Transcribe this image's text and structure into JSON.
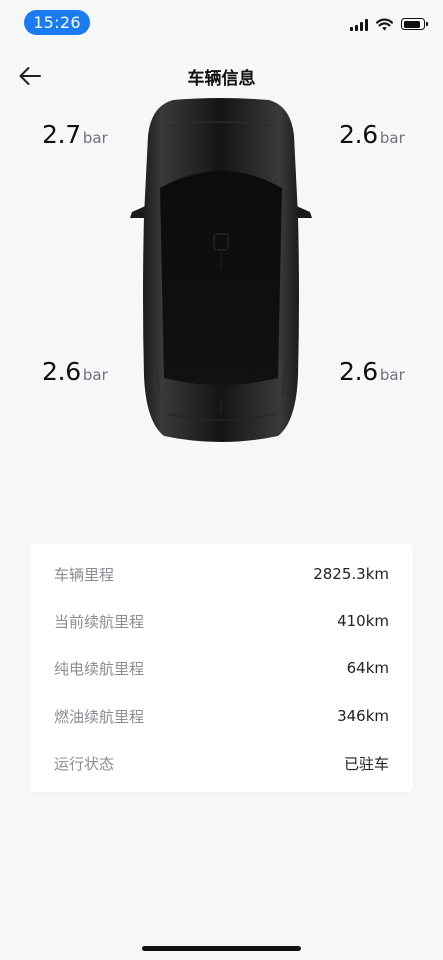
{
  "status_bar": {
    "time": "15:26",
    "accent_color": "#1a7cf0",
    "icons": [
      "signal-icon",
      "wifi-icon",
      "battery-icon"
    ],
    "battery_level": 0.8
  },
  "nav": {
    "title": "车辆信息",
    "back_icon": "arrow-left-icon"
  },
  "tires": {
    "unit": "bar",
    "front_left": "2.7",
    "front_right": "2.6",
    "rear_left": "2.6",
    "rear_right": "2.6"
  },
  "vehicle_info": [
    {
      "label": "车辆里程",
      "value": "2825.3km"
    },
    {
      "label": "当前续航里程",
      "value": "410km"
    },
    {
      "label": "纯电续航里程",
      "value": "64km"
    },
    {
      "label": "燃油续航里程",
      "value": "346km"
    },
    {
      "label": "运行状态",
      "value": "已驻车"
    }
  ]
}
